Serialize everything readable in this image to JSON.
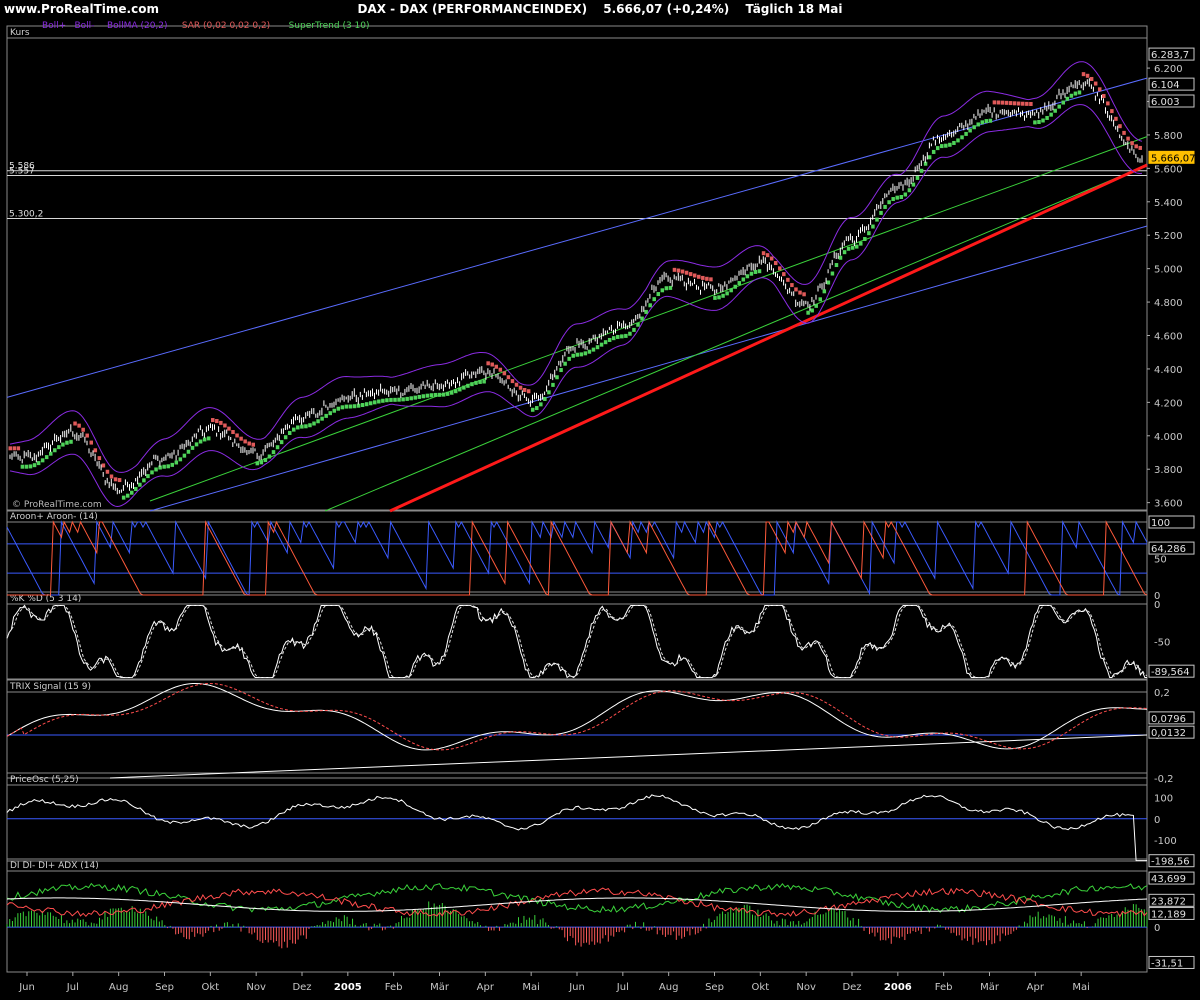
{
  "header": {
    "site": "www.ProRealTime.com",
    "instrument": "DAX - DAX (PERFORMANCEINDEX)",
    "last": "5.666,07 (+0,24%)",
    "period": "Täglich  18 Mai"
  },
  "colors": {
    "background": "#000000",
    "price": "#ffffff",
    "supertrend_up": "#4fd35a",
    "supertrend_down": "#e05a5a",
    "bollinger": "#8a2be2",
    "channel_blue": "#5a6cff",
    "channel_green": "#3bd23b",
    "trendline": "#ff1a1a",
    "aroon_up": "#3b5bff",
    "aroon_down": "#ff5a3b",
    "axis_text": "#c8c8c8",
    "last_price_tag": "#ffc000"
  },
  "chart_data": [
    {
      "id": "price",
      "type": "line",
      "title": "Kurs",
      "legend": [
        "Boll+",
        "Boll-",
        "BollMA (20,2)",
        "SAR (0,02 0,02 0,2)",
        "SuperTrend (3 10)"
      ],
      "x": [
        "Jun",
        "Jul",
        "Aug",
        "Sep",
        "Okt",
        "Nov",
        "Dez",
        "2005",
        "Feb",
        "Mär",
        "Apr",
        "Mai",
        "Jun",
        "Jul",
        "Aug",
        "Sep",
        "Okt",
        "Nov",
        "Dez",
        "2006",
        "Feb",
        "Mär",
        "Apr",
        "Mai",
        "18 Mai"
      ],
      "y": [
        3870,
        4020,
        3680,
        3870,
        4040,
        3890,
        4110,
        4230,
        4270,
        4300,
        4380,
        4210,
        4540,
        4650,
        4940,
        4880,
        5040,
        4790,
        5180,
        5480,
        5790,
        5940,
        5930,
        6110,
        5666.07
      ],
      "ylim": [
        3550,
        6380
      ],
      "yticks": [
        "3.600",
        "3.800",
        "4.000",
        "4.200",
        "4.400",
        "4.600",
        "4.800",
        "5.000",
        "5.200",
        "5.400",
        "5.600",
        "5.800",
        "6.000",
        "6.200"
      ],
      "annotations": [
        {
          "text": "5.586",
          "value": 5586
        },
        {
          "text": "5.557",
          "value": 5557
        },
        {
          "text": "5.300,2",
          "value": 5300.2
        }
      ],
      "right_tags": [
        {
          "text": "6.283,7",
          "value": 6283.7
        },
        {
          "text": "6.104",
          "value": 6104
        },
        {
          "text": "6.003",
          "value": 6003
        },
        {
          "text": "5.666,07",
          "value": 5666.07
        }
      ],
      "watermark": "© ProRealTime.com"
    },
    {
      "id": "aroon",
      "type": "line",
      "title": "Aroon+ Aroon- (14)",
      "series": [
        {
          "name": "Aroon+"
        },
        {
          "name": "Aroon-"
        }
      ],
      "ylim": [
        0,
        100
      ],
      "yticks": [
        "100",
        "50",
        "0"
      ],
      "right_tags": [
        {
          "text": "100",
          "value": 100
        },
        {
          "text": "64,286",
          "value": 64.286
        }
      ]
    },
    {
      "id": "stoch",
      "type": "line",
      "title": "%K %D (5 3 14)",
      "ylim": [
        -100,
        0
      ],
      "yticks": [
        "0",
        "-50"
      ],
      "right_tags": [
        {
          "text": "-89,564",
          "value": -89.564
        }
      ]
    },
    {
      "id": "trix",
      "type": "line",
      "title": "TRIX Signal (15 9)",
      "ylim": [
        -0.2,
        0.2
      ],
      "yticks": [
        "0,2",
        "0",
        "-0,2"
      ],
      "right_tags": [
        {
          "text": "0,0796",
          "value": 0.0796
        },
        {
          "text": "0,0132",
          "value": 0.0132
        }
      ]
    },
    {
      "id": "priceosc",
      "type": "line",
      "title": "PriceOsc (5,25)",
      "ylim": [
        -200,
        160
      ],
      "yticks": [
        "100",
        "0",
        "-100"
      ],
      "right_tags": [
        {
          "text": "-198,56",
          "value": -198.56
        }
      ]
    },
    {
      "id": "dmi",
      "type": "line",
      "title": "DI DI- DI+ ADX (14)",
      "ylim": [
        -40,
        50
      ],
      "yticks": [
        "0"
      ],
      "right_tags": [
        {
          "text": "43,699",
          "value": 43.699
        },
        {
          "text": "23,872",
          "value": 23.872
        },
        {
          "text": "12,189",
          "value": 12.189
        },
        {
          "text": "-31,51",
          "value": -31.51
        }
      ]
    }
  ]
}
